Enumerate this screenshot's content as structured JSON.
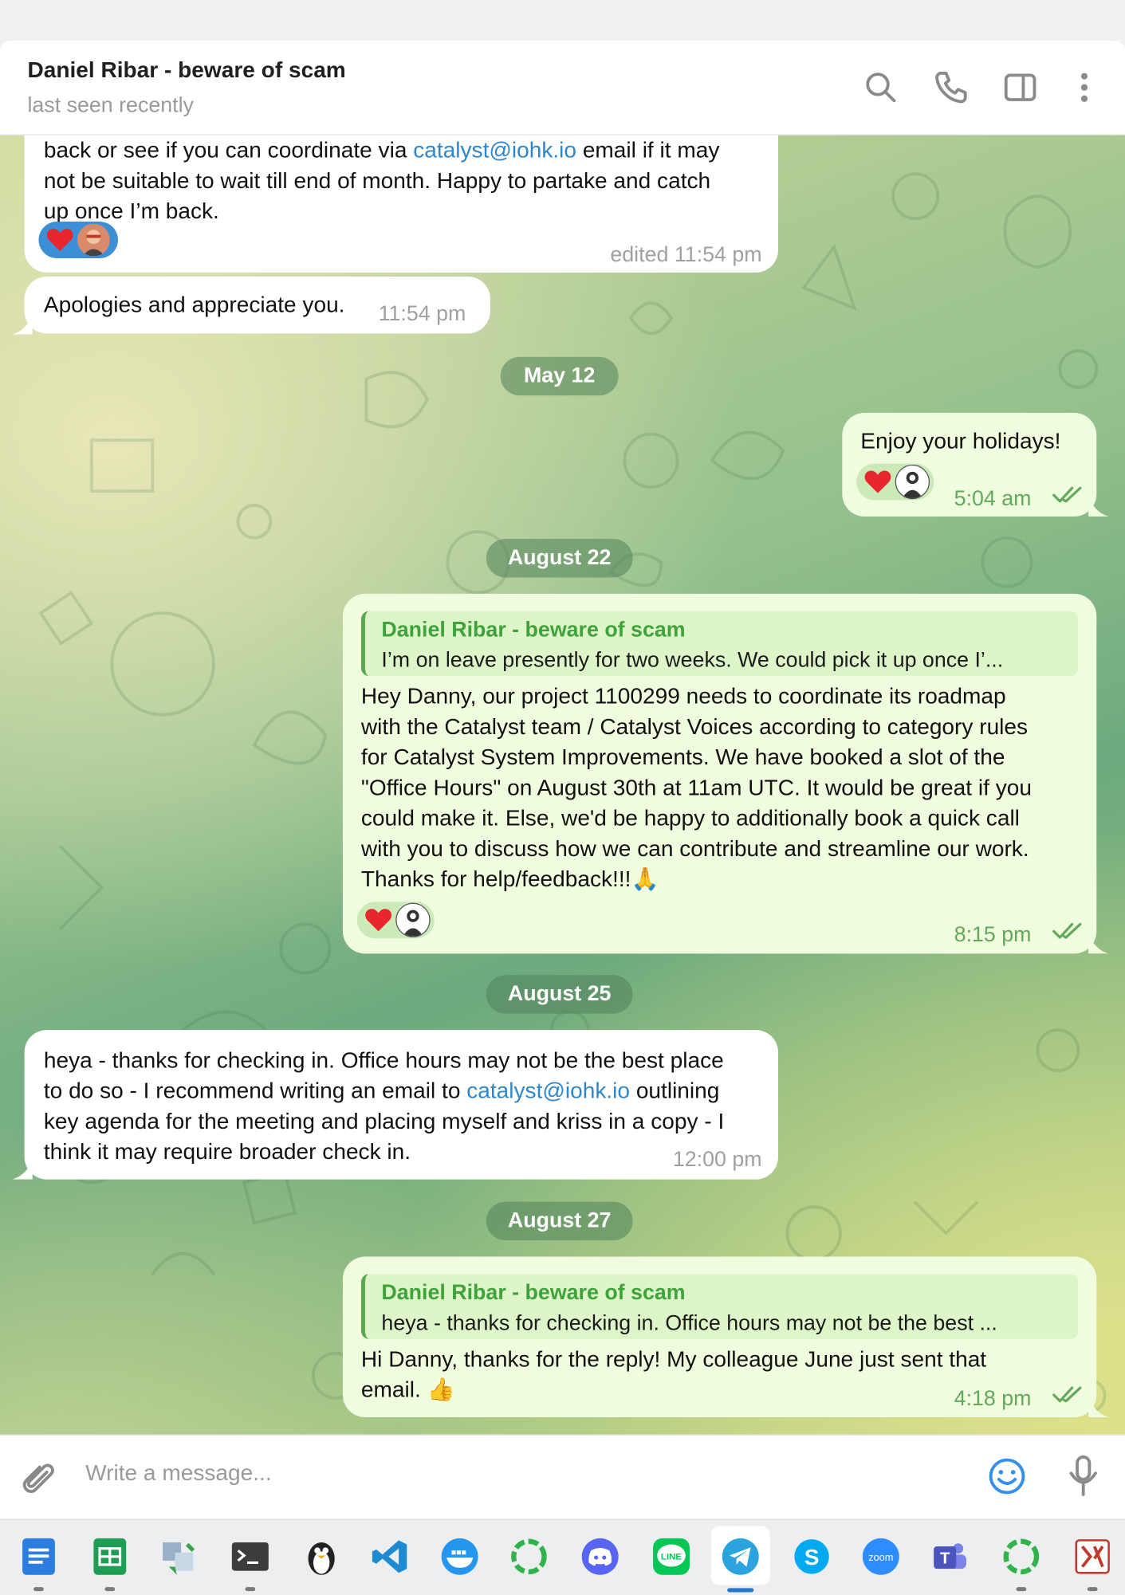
{
  "header": {
    "title": "Daniel Ribar - beware of scam",
    "status": "last seen recently"
  },
  "messages": [
    {
      "text_pre": "back or see if you can coordinate via ",
      "link": "catalyst@iohk.io",
      "text_post": " email if it may\nnot be suitable to wait till end of month. Happy to partake and catch\nup once I’m back.",
      "time": "edited 11:54 pm"
    },
    {
      "text": "Apologies and appreciate you.",
      "time": "11:54 pm"
    },
    {
      "text": "Enjoy your holidays!",
      "time": "5:04 am"
    },
    {
      "reply_name": "Daniel Ribar - beware of scam",
      "reply_text": "I’m on leave presently for two weeks. We could pick it up once I’...",
      "text": "Hey Danny, our project 1100299 needs to coordinate its roadmap\nwith the Catalyst team / Catalyst Voices according to category rules\nfor Catalyst System Improvements. We have booked a slot of the\n\"Office Hours\" on August 30th at 11am UTC. It would be great if you\ncould make it. Else, we'd be happy to additionally book a quick call\nwith you to discuss how we can contribute and streamline our work.\nThanks for help/feedback!!!",
      "emoji": "🙏",
      "time": "8:15 pm"
    },
    {
      "text_pre": "heya - thanks for checking in. Office hours may not be the best place\nto do so - I recommend writing an email to ",
      "link": "catalyst@iohk.io",
      "text_post": " outlining\nkey agenda for the meeting and placing myself and kriss in a copy - I\nthink it may require broader check in.",
      "time": "12:00 pm"
    },
    {
      "reply_name": "Daniel Ribar - beware of scam",
      "reply_text": "heya - thanks for checking in. Office hours may not be the best ...",
      "text": "Hi Danny, thanks for the reply! My colleague June just sent that\nemail.",
      "emoji": "👍",
      "time": "4:18 pm"
    }
  ],
  "dates": [
    "May 12",
    "August 22",
    "August 25",
    "August 27"
  ],
  "composer": {
    "placeholder": "Write a message..."
  },
  "colors": {
    "outgoing_bubble": "#effdde",
    "incoming_bubble": "#ffffff",
    "accent_green": "#3ea33a",
    "link_blue": "#2f86c9"
  },
  "taskbar": {
    "apps": [
      "docs-icon",
      "sheets-icon",
      "transfer-icon",
      "terminal-icon",
      "tux-icon",
      "vscode-icon",
      "docker-icon",
      "ring-app-icon",
      "discord-icon",
      "line-icon",
      "telegram-icon",
      "skype-icon",
      "zoom-icon",
      "teams-icon",
      "ring-app-icon",
      "ks-icon"
    ],
    "zoom_label": "zoom",
    "line_label": "LINE",
    "teams_label": "T",
    "skype_label": "S"
  }
}
